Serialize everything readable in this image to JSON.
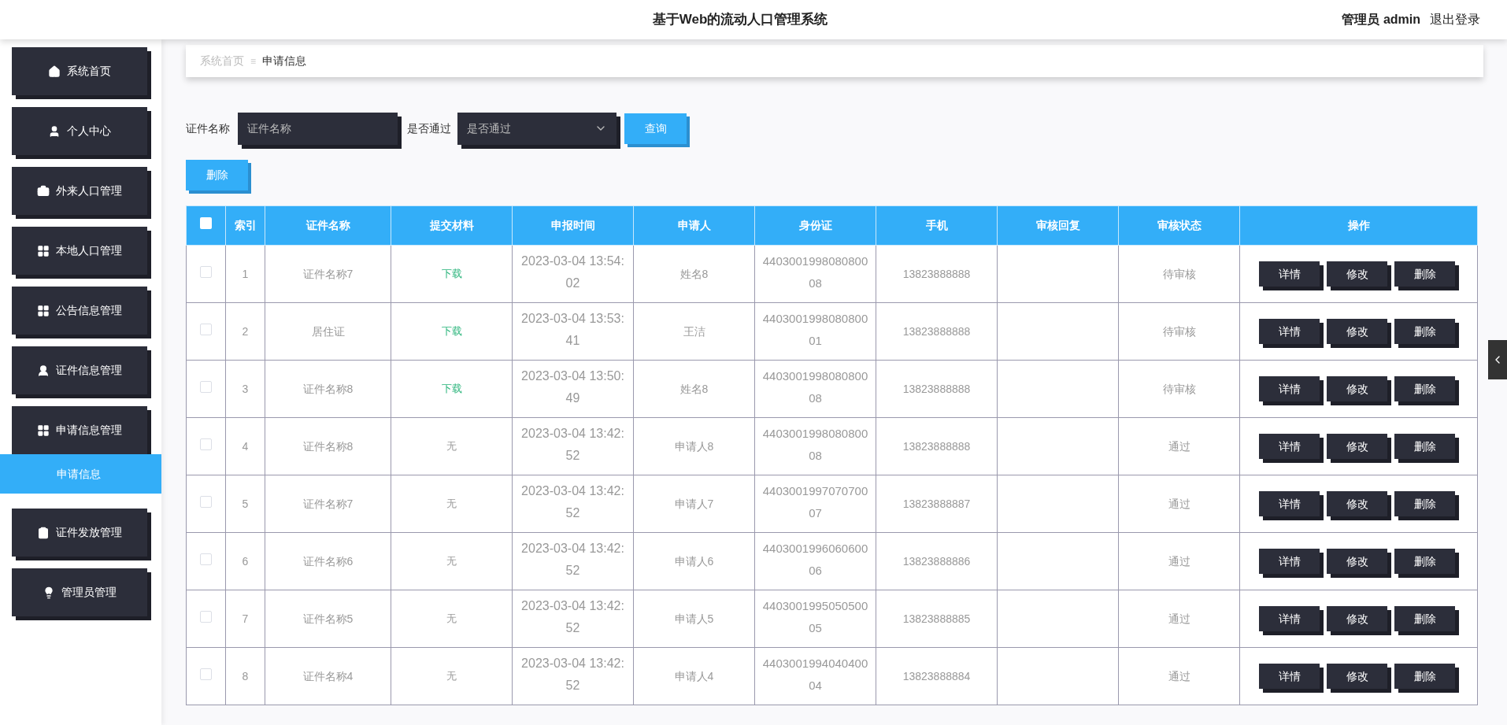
{
  "header": {
    "title": "基于Web的流动人口管理系统",
    "user": "管理员 admin",
    "logout": "退出登录"
  },
  "sidebar": {
    "items": [
      {
        "label": "系统首页"
      },
      {
        "label": "个人中心"
      },
      {
        "label": "外来人口管理"
      },
      {
        "label": "本地人口管理"
      },
      {
        "label": "公告信息管理"
      },
      {
        "label": "证件信息管理"
      },
      {
        "label": "申请信息管理",
        "children": [
          {
            "label": "申请信息",
            "selected": true
          }
        ]
      },
      {
        "label": "证件发放管理"
      },
      {
        "label": "管理员管理"
      }
    ]
  },
  "breadcrumb": {
    "items": [
      "系统首页",
      "申请信息"
    ],
    "separator": "≡"
  },
  "search": {
    "name_label": "证件名称",
    "name_placeholder": "证件名称",
    "pass_label": "是否通过",
    "pass_placeholder": "是否通过",
    "query_button": "查询"
  },
  "delete_button": "删除",
  "table": {
    "select_all_checked": false,
    "columns": [
      "索引",
      "证件名称",
      "提交材料",
      "申报时间",
      "申请人",
      "身份证",
      "手机",
      "审核回复",
      "审核状态",
      "操作"
    ],
    "rows": [
      {
        "checked": false,
        "index": "1",
        "name": "证件名称7",
        "material": "下载",
        "kind": "link",
        "time": "2023-03-04 13:54:02",
        "applicant": "姓名8",
        "id_card": "440300199808080008",
        "phone": "13823888888",
        "status": "待审核",
        "actions": [
          "详情",
          "修改",
          "删除"
        ]
      },
      {
        "checked": false,
        "index": "2",
        "name": "居住证",
        "material": "下载",
        "kind": "link",
        "time": "2023-03-04 13:53:41",
        "applicant": "王洁",
        "id_card": "440300199808080001",
        "phone": "13823888888",
        "status": "待审核",
        "actions": [
          "详情",
          "修改",
          "删除"
        ]
      },
      {
        "checked": false,
        "index": "3",
        "name": "证件名称8",
        "material": "下载",
        "kind": "link",
        "time": "2023-03-04 13:50:49",
        "applicant": "姓名8",
        "id_card": "440300199808080008",
        "phone": "13823888888",
        "status": "待审核",
        "actions": [
          "详情",
          "修改",
          "删除"
        ]
      },
      {
        "checked": false,
        "index": "4",
        "name": "证件名称8",
        "material": "无",
        "kind": "text",
        "time": "2023-03-04 13:42:52",
        "applicant": "申请人8",
        "id_card": "440300199808080008",
        "phone": "13823888888",
        "status": "通过",
        "actions": [
          "详情",
          "修改",
          "删除"
        ]
      },
      {
        "checked": false,
        "index": "5",
        "name": "证件名称7",
        "material": "无",
        "kind": "text",
        "time": "2023-03-04 13:42:52",
        "applicant": "申请人7",
        "id_card": "440300199707070007",
        "phone": "13823888887",
        "status": "通过",
        "actions": [
          "详情",
          "修改",
          "删除"
        ]
      },
      {
        "checked": false,
        "index": "6",
        "name": "证件名称6",
        "material": "无",
        "kind": "text",
        "time": "2023-03-04 13:42:52",
        "applicant": "申请人6",
        "id_card": "440300199606060006",
        "phone": "13823888886",
        "status": "通过",
        "actions": [
          "详情",
          "修改",
          "删除"
        ]
      },
      {
        "checked": false,
        "index": "7",
        "name": "证件名称5",
        "material": "无",
        "kind": "text",
        "time": "2023-03-04 13:42:52",
        "applicant": "申请人5",
        "id_card": "440300199505050005",
        "phone": "13823888885",
        "status": "通过",
        "actions": [
          "详情",
          "修改",
          "删除"
        ]
      },
      {
        "checked": false,
        "index": "8",
        "name": "证件名称4",
        "material": "无",
        "kind": "text",
        "time": "2023-03-04 13:42:52",
        "applicant": "申请人4",
        "id_card": "440300199404040004",
        "phone": "13823888884",
        "status": "通过",
        "actions": [
          "详情",
          "修改",
          "删除"
        ]
      }
    ]
  }
}
